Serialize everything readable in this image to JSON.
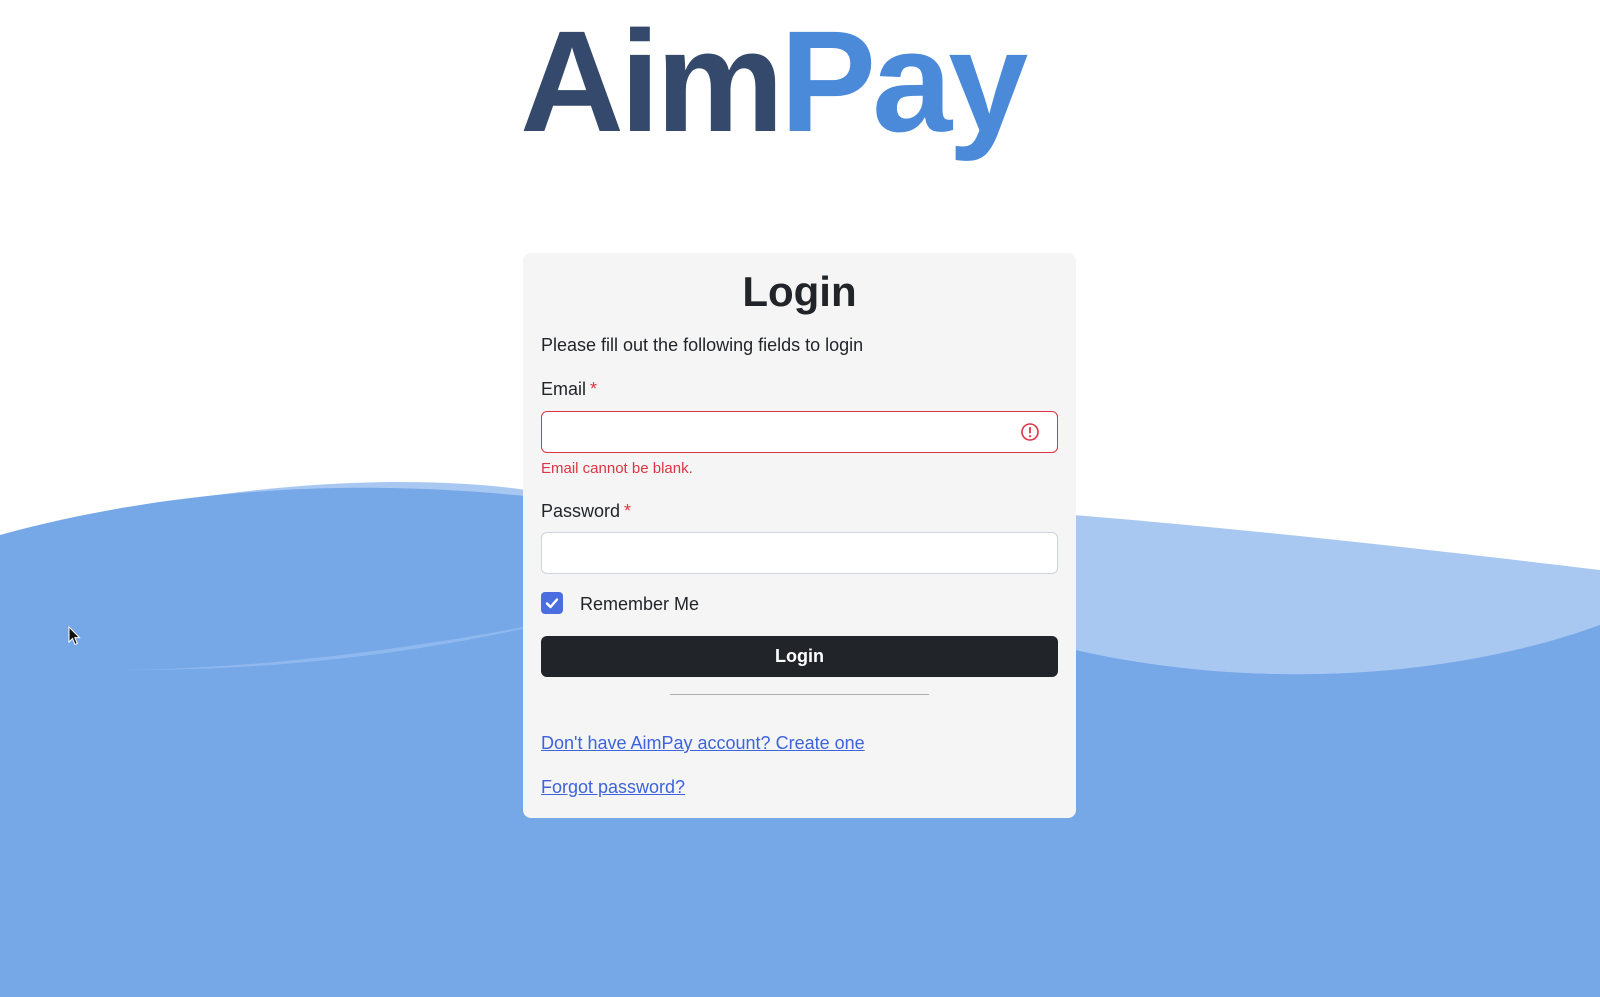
{
  "logo": {
    "part1": "Aim",
    "part2": "Pay",
    "part1_color": "#34496b",
    "part2_color": "#4a8ad9"
  },
  "background": {
    "wave_light": "#a9c8f1",
    "wave_mid": "#8fb8ee",
    "wave_dark": "#76a8e8"
  },
  "form": {
    "title": "Login",
    "intro": "Please fill out the following fields to login",
    "email": {
      "label": "Email",
      "required_mark": "*",
      "value": "",
      "error": "Email cannot be blank."
    },
    "password": {
      "label": "Password",
      "required_mark": "*",
      "value": ""
    },
    "remember_me": {
      "label": "Remember Me",
      "checked": true
    },
    "submit_label": "Login",
    "signup_link": "Don't have AimPay account? Create one",
    "forgot_link": "Forgot password?"
  },
  "colors": {
    "error": "#dc3545",
    "link": "#3d63dd",
    "button": "#212529",
    "checkbox": "#4a6ee0"
  }
}
